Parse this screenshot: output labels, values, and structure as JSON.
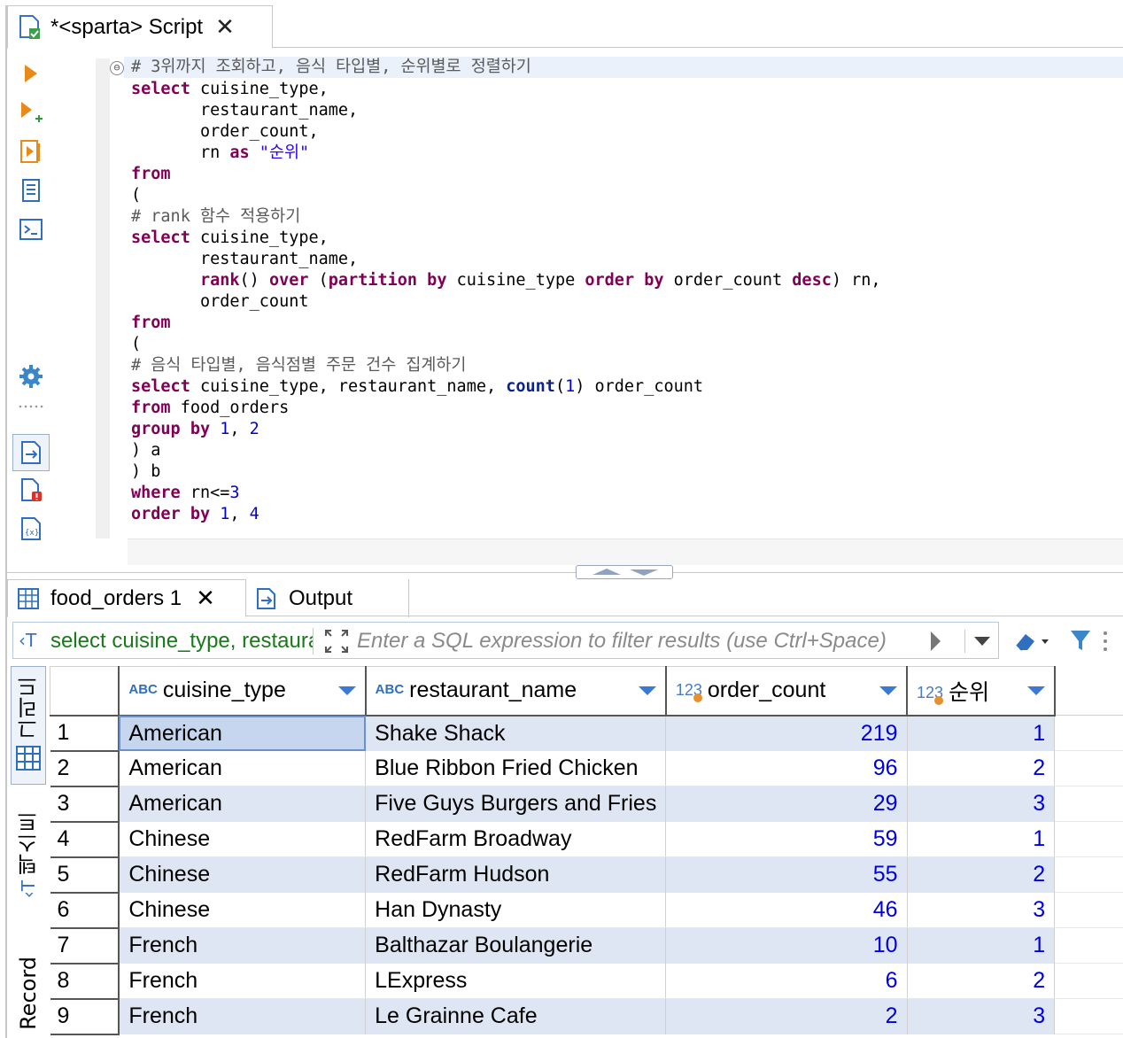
{
  "editor": {
    "tab_title": "*<sparta> Script",
    "tab_close": "✕",
    "fold_marker": "⊖",
    "code": {
      "l1": "# 3위까지 조회하고, 음식 타입별, 순위별로 정렬하기",
      "l2_kw": "select",
      "l2_rest": " cuisine_type,",
      "l3": "       restaurant_name,",
      "l4": "       order_count,",
      "l5_a": "       rn ",
      "l5_kw": "as",
      "l5_str": " \"순위\"",
      "l6": "from",
      "l7": "(",
      "l8": "# rank 함수 적용하기",
      "l9_kw": "select",
      "l9_rest": " cuisine_type,",
      "l10": "       restaurant_name,",
      "l11_indent": "       ",
      "l11_rank": "rank",
      "l11_p": "() ",
      "l11_over": "over",
      "l11_sp": " (",
      "l11_part": "partition by",
      "l11_ct": " cuisine_type ",
      "l11_order": "order by",
      "l11_oc": " order_count ",
      "l11_desc": "desc",
      "l11_end": ") rn,",
      "l12": "       order_count",
      "l13": "from",
      "l14": "(",
      "l15": "# 음식 타입별, 음식점별 주문 건수 집계하기",
      "l16_kw": "select",
      "l16_rest": " cuisine_type, restaurant_name, ",
      "l16_count": "count",
      "l16_p1": "(",
      "l16_one": "1",
      "l16_p2": ") order_count",
      "l17_kw": "from",
      "l17_rest": " food_orders",
      "l18_kw": "group by",
      "l18_sp": " ",
      "l18_n1": "1",
      "l18_comma": ", ",
      "l18_n2": "2",
      "l19": ") a",
      "l20": ") b",
      "l21_kw": "where",
      "l21_rest": " rn<=",
      "l21_n": "3",
      "l22_kw": "order by",
      "l22_sp": " ",
      "l22_n1": "1",
      "l22_comma": ", ",
      "l22_n2": "4"
    }
  },
  "results": {
    "tabs": [
      {
        "label": "food_orders 1",
        "close": "✕"
      },
      {
        "label": "Output"
      }
    ],
    "filter": {
      "sql_preview": "select cuisine_type, restaurant_name, order_count, rn as \"순위\"",
      "placeholder": "Enter a SQL expression to filter results (use Ctrl+Space)"
    },
    "side_tabs": [
      "그리드",
      "텍스트",
      "Record"
    ],
    "columns": [
      {
        "type_badge": "ABC",
        "name": "cuisine_type"
      },
      {
        "type_badge": "ABC",
        "name": "restaurant_name"
      },
      {
        "type_badge": "123",
        "name": "order_count"
      },
      {
        "type_badge": "123",
        "name": "순위"
      }
    ],
    "rows": [
      {
        "n": "1",
        "cuisine_type": "American",
        "restaurant_name": "Shake Shack",
        "order_count": "219",
        "rank": "1"
      },
      {
        "n": "2",
        "cuisine_type": "American",
        "restaurant_name": "Blue Ribbon Fried Chicken",
        "order_count": "96",
        "rank": "2"
      },
      {
        "n": "3",
        "cuisine_type": "American",
        "restaurant_name": "Five Guys Burgers and Fries",
        "order_count": "29",
        "rank": "3"
      },
      {
        "n": "4",
        "cuisine_type": "Chinese",
        "restaurant_name": "RedFarm Broadway",
        "order_count": "59",
        "rank": "1"
      },
      {
        "n": "5",
        "cuisine_type": "Chinese",
        "restaurant_name": "RedFarm Hudson",
        "order_count": "55",
        "rank": "2"
      },
      {
        "n": "6",
        "cuisine_type": "Chinese",
        "restaurant_name": "Han Dynasty",
        "order_count": "46",
        "rank": "3"
      },
      {
        "n": "7",
        "cuisine_type": "French",
        "restaurant_name": "Balthazar Boulangerie",
        "order_count": "10",
        "rank": "1"
      },
      {
        "n": "8",
        "cuisine_type": "French",
        "restaurant_name": "LExpress",
        "order_count": "6",
        "rank": "2"
      },
      {
        "n": "9",
        "cuisine_type": "French",
        "restaurant_name": "Le Grainne Cafe",
        "order_count": "2",
        "rank": "3"
      }
    ]
  },
  "colors": {
    "keyword": "#7f0055",
    "comment": "#5a5a5a",
    "string": "#2a00ff",
    "number": "#0000dd",
    "row_stripe": "#dfe6f3",
    "sql_preview": "#1a7a1a",
    "accent": "#3a7ad4"
  }
}
